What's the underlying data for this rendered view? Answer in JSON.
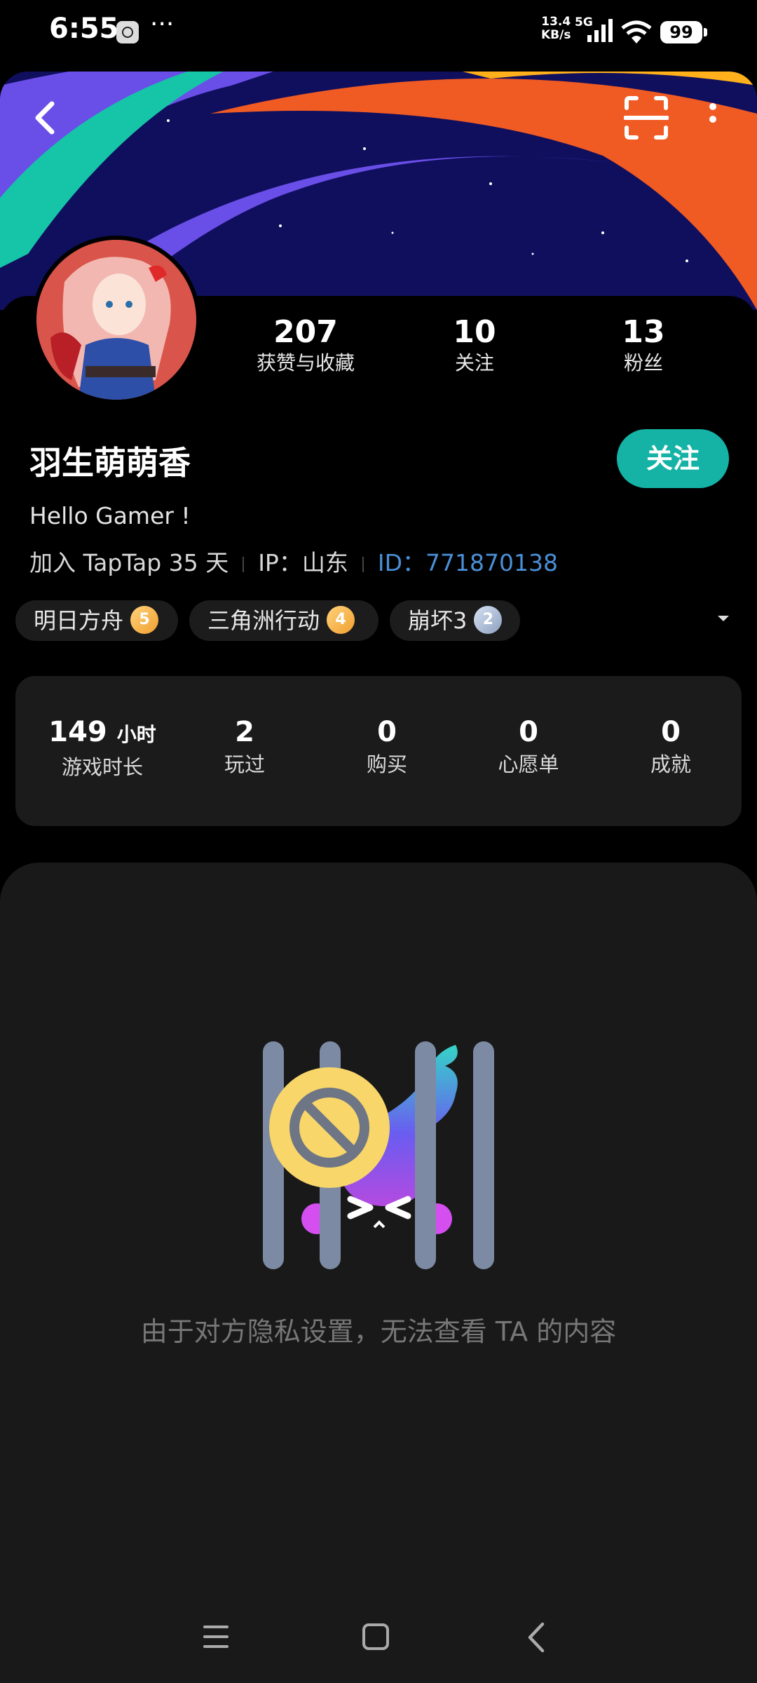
{
  "status_bar": {
    "time": "6:55",
    "more": "···",
    "net_speed_value": "13.4",
    "net_speed_unit": "KB/s",
    "network_type": "5G",
    "battery": "99",
    "icons": [
      "clock-icon",
      "signal-icon",
      "wifi-icon",
      "battery-icon"
    ]
  },
  "header": {
    "icons": [
      "back-arrow-icon",
      "scan-icon",
      "more-vertical-icon"
    ]
  },
  "profile": {
    "stats": [
      {
        "value": "207",
        "label": "获赞与收藏"
      },
      {
        "value": "10",
        "label": "关注"
      },
      {
        "value": "13",
        "label": "粉丝"
      }
    ],
    "username": "羽生萌萌香",
    "follow_label": "关注",
    "bio": "Hello Gamer !",
    "joined": "加入 TapTap 35 天",
    "ip": "IP：山东",
    "user_id": "ID：771870138",
    "tags": [
      {
        "name": "明日方舟",
        "level": "5",
        "badge_color": "#f0a030"
      },
      {
        "name": "三角洲行动",
        "level": "4",
        "badge_color": "#f0a030"
      },
      {
        "name": "崩坏3",
        "level": "2",
        "badge_color": "#8ca0bf"
      }
    ]
  },
  "game_stats": [
    {
      "value": "149",
      "unit": "小时",
      "label": "游戏时长"
    },
    {
      "value": "2",
      "label": "玩过"
    },
    {
      "value": "0",
      "label": "购买"
    },
    {
      "value": "0",
      "label": "心愿单"
    },
    {
      "value": "0",
      "label": "成就"
    }
  ],
  "content": {
    "empty_message": "由于对方隐私设置，无法查看 TA 的内容"
  },
  "nav_bar": {
    "icons": [
      "menu-icon",
      "home-square-icon",
      "back-chevron-icon"
    ]
  },
  "colors": {
    "accent": "#14b3a6",
    "id_link": "#4a8fd6",
    "background": "#000000",
    "card": "#1b1b1b"
  }
}
